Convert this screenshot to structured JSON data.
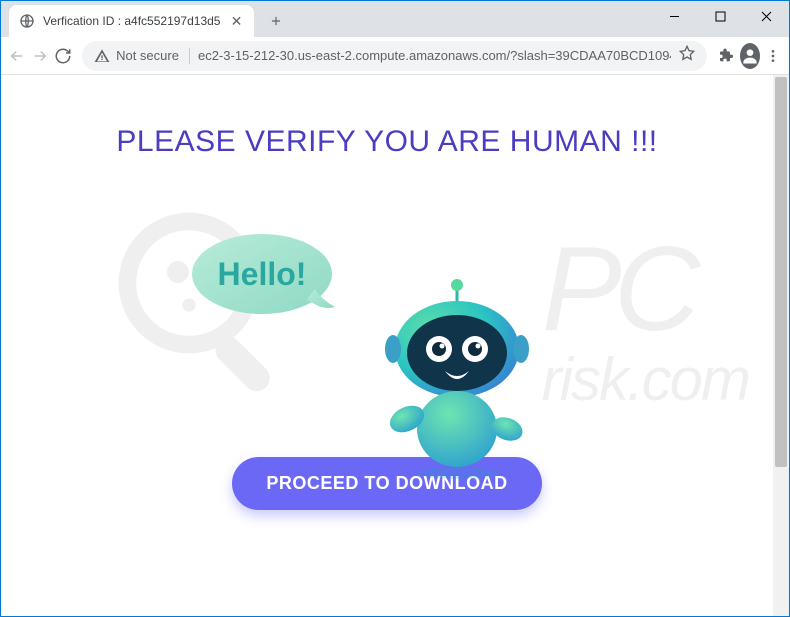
{
  "window": {
    "tab_title": "Verfication ID : a4fc552197d13d5"
  },
  "toolbar": {
    "security_label": "Not secure",
    "url": "ec2-3-15-212-30.us-east-2.compute.amazonaws.com/?slash=39CDAA70BCD10947..."
  },
  "page": {
    "headline": "PLEASE VERIFY YOU ARE HUMAN !!!",
    "speech_text": "Hello!",
    "cta_label": "PROCEED TO DOWNLOAD"
  },
  "watermark": {
    "text": "pcrisk.com"
  }
}
